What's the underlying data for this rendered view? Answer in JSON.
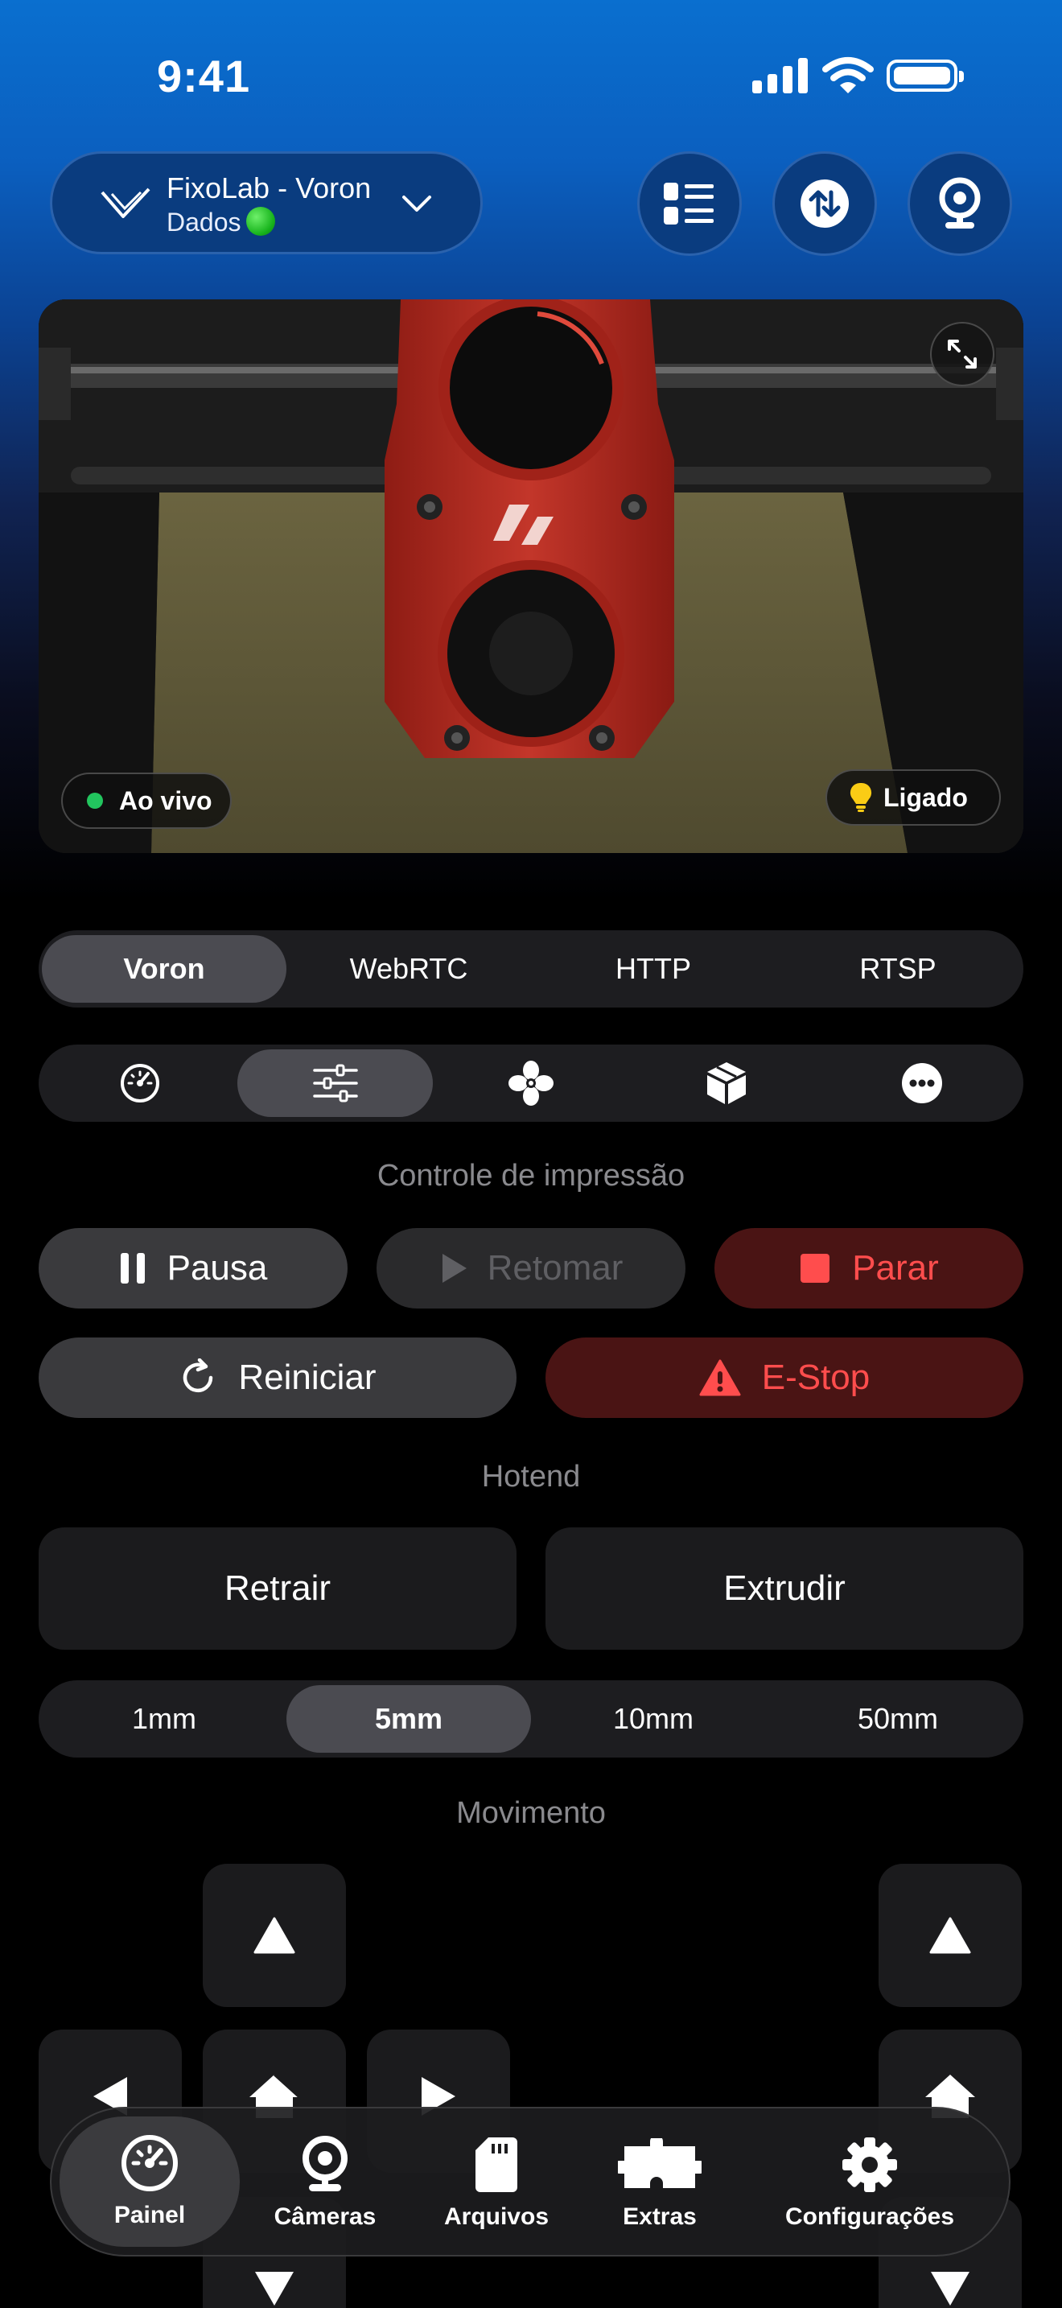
{
  "status_bar": {
    "time": "9:41"
  },
  "header": {
    "printer_name": "FixoLab - Voron",
    "printer_sub": "Dados",
    "icons": [
      "list-icon",
      "transfer-icon",
      "webcam-icon"
    ]
  },
  "camera": {
    "live_label": "Ao vivo",
    "light_label": "Ligado",
    "live_color": "#22c55e"
  },
  "stream_tabs": [
    "Voron",
    "WebRTC",
    "HTTP",
    "RTSP"
  ],
  "stream_selected": "Voron",
  "tool_tabs": [
    "gauge-icon",
    "sliders-icon",
    "fan-icon",
    "cube-icon",
    "more-icon"
  ],
  "tool_selected": "sliders-icon",
  "print_control": {
    "title": "Controle de impressão",
    "pause": "Pausa",
    "resume": "Retomar",
    "stop": "Parar",
    "restart": "Reiniciar",
    "estop": "E-Stop"
  },
  "hotend": {
    "title": "Hotend",
    "retract": "Retrair",
    "extrude": "Extrudir",
    "distances": [
      "1mm",
      "5mm",
      "10mm",
      "50mm"
    ],
    "selected": "5mm"
  },
  "movement": {
    "title": "Movimento"
  },
  "tabbar": {
    "items": [
      {
        "label": "Painel",
        "icon": "gauge-icon"
      },
      {
        "label": "Câmeras",
        "icon": "webcam-icon"
      },
      {
        "label": "Arquivos",
        "icon": "sd-card-icon"
      },
      {
        "label": "Extras",
        "icon": "puzzle-icon"
      },
      {
        "label": "Configurações",
        "icon": "gear-icon"
      }
    ],
    "selected": "Painel"
  },
  "colors": {
    "accent_red": "#ff4d4d",
    "header_blue": "#0a3c7f"
  }
}
